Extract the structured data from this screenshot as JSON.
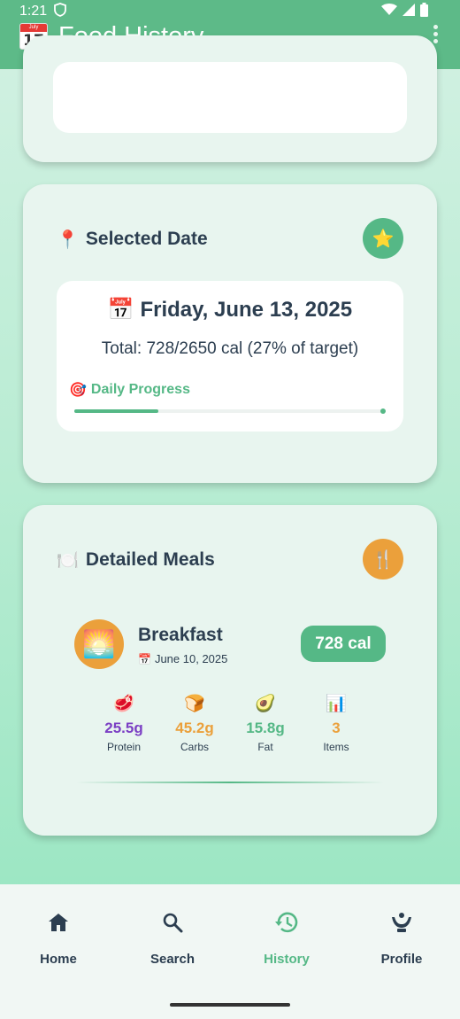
{
  "status_bar": {
    "time": "1:21"
  },
  "app_bar": {
    "calendar_month": "July",
    "calendar_day": "17",
    "title": "Food History"
  },
  "selected_date_card": {
    "icon": "📍",
    "title": "Selected Date",
    "action_icon": "⭐",
    "date_icon": "📅",
    "date": "Friday, June 13, 2025",
    "total_text": "Total: 728/2650 cal (27% of target)",
    "progress_icon": "🎯",
    "progress_label": "Daily Progress",
    "progress_fraction": 0.27
  },
  "meals_card": {
    "icon": "🍽️",
    "title": "Detailed Meals",
    "action_icon": "🍴",
    "meal": {
      "icon": "🌅",
      "name": "Breakfast",
      "date_icon": "📅",
      "date": "June 10, 2025",
      "calories": "728 cal"
    },
    "macros": [
      {
        "icon": "🥩",
        "value": "25.5g",
        "label": "Protein",
        "color": "#7b3fc4"
      },
      {
        "icon": "🍞",
        "value": "45.2g",
        "label": "Carbs",
        "color": "#eba03b"
      },
      {
        "icon": "🥑",
        "value": "15.8g",
        "label": "Fat",
        "color": "#55b886"
      },
      {
        "icon": "📊",
        "value": "3",
        "label": "Items",
        "color": "#eba03b"
      }
    ]
  },
  "bottom_nav": {
    "items": [
      {
        "label": "Home",
        "icon": "home-icon"
      },
      {
        "label": "Search",
        "icon": "search-icon"
      },
      {
        "label": "History",
        "icon": "history-icon",
        "active": true
      },
      {
        "label": "Profile",
        "icon": "profile-icon"
      }
    ]
  },
  "colors": {
    "primary": "#5dba88",
    "accent_green": "#55b886",
    "accent_orange": "#eba03b"
  }
}
